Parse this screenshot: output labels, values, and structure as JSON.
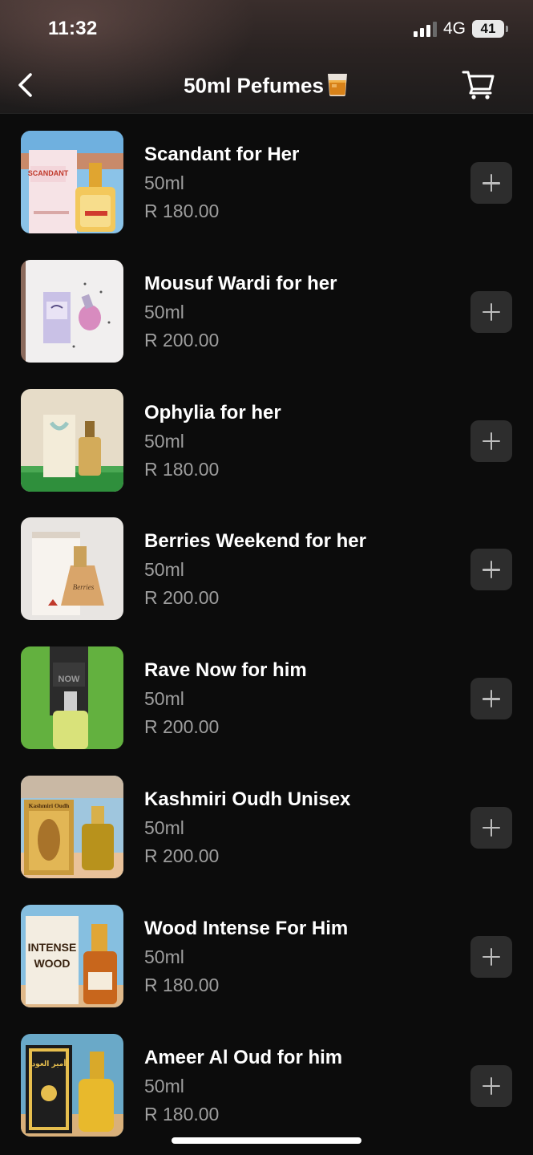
{
  "status_bar": {
    "time": "11:32",
    "network": "4G",
    "battery": "41"
  },
  "header": {
    "title": "50ml Pefumes",
    "title_emoji": "whisky-glass-icon",
    "back_icon": "chevron-left-icon",
    "cart_icon": "cart-icon"
  },
  "colors": {
    "background": "#0c0c0c",
    "muted_text": "#9e9e9e",
    "add_button_bg": "#2d2d2d"
  },
  "products": [
    {
      "name": "Scandant for Her",
      "size": "50ml",
      "price": "R 180.00",
      "image_text": "SCANDANT"
    },
    {
      "name": "Mousuf Wardi for her",
      "size": "50ml",
      "price": "R 200.00",
      "image_text": ""
    },
    {
      "name": "Ophylia for her",
      "size": "50ml",
      "price": "R 180.00",
      "image_text": ""
    },
    {
      "name": "Berries Weekend for her",
      "size": "50ml",
      "price": "R 200.00",
      "image_text": ""
    },
    {
      "name": "Rave Now for him",
      "size": "50ml",
      "price": "R 200.00",
      "image_text": "NOW"
    },
    {
      "name": "Kashmiri Oudh Unisex",
      "size": "50ml",
      "price": "R 200.00",
      "image_text": "Kashmiri Oudh"
    },
    {
      "name": "Wood Intense For Him",
      "size": "50ml",
      "price": "R 180.00",
      "image_text": "INTENSE WOOD"
    },
    {
      "name": "Ameer Al Oud for him",
      "size": "50ml",
      "price": "R 180.00",
      "image_text": "أمير العود"
    }
  ]
}
